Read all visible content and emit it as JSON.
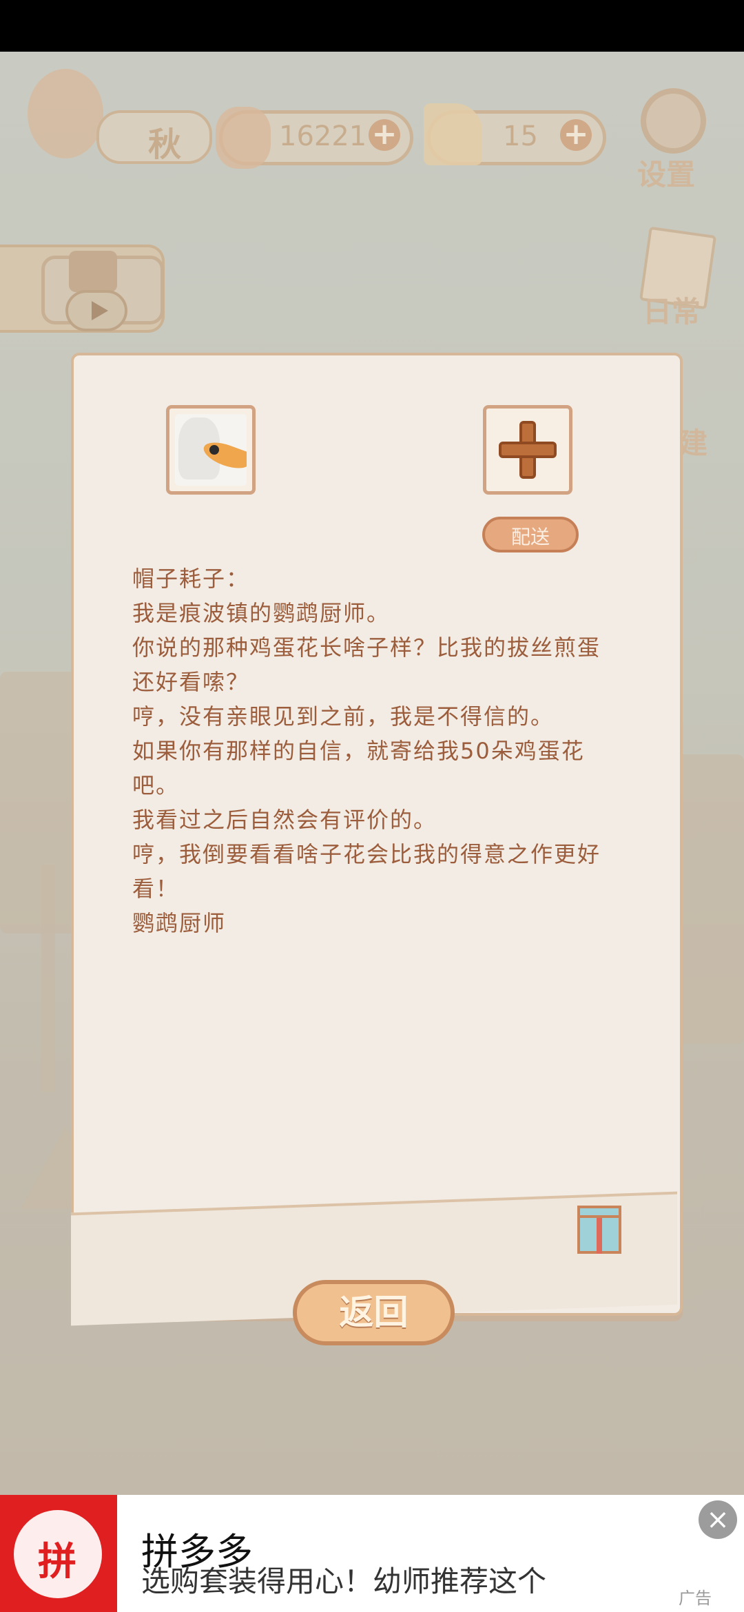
{
  "hud": {
    "season_label": "秋",
    "fish_count": "16221",
    "cheese_count": "15",
    "settings_label": "设置",
    "daily_label": "日常",
    "build_label": "建"
  },
  "letter": {
    "send_label": "配送",
    "lines": [
      "帽子耗子：",
      "我是痕波镇的鹦鹉厨师。",
      "你说的那种鸡蛋花长啥子样？比我的拔丝煎蛋",
      "还好看嗦？",
      "哼，没有亲眼见到之前，我是不得信的。",
      "如果你有那样的自信，就寄给我50朵鸡蛋花",
      "吧。",
      "我看过之后自然会有评价的。",
      "哼，我倒要看看啥子花会比我的得意之作更好",
      "看！",
      "鹦鹉厨师"
    ],
    "back_label": "返回"
  },
  "ad": {
    "title": "拼多多",
    "subtitle": "选购套装得用心！幼师推荐这个",
    "logo_text": "拼",
    "tag": "广告",
    "close_icon": "close-icon"
  },
  "colors": {
    "paper": "#f3ece4",
    "text": "#9b5d3c",
    "accent": "#e6a87f",
    "ad_brand": "#e02020"
  }
}
